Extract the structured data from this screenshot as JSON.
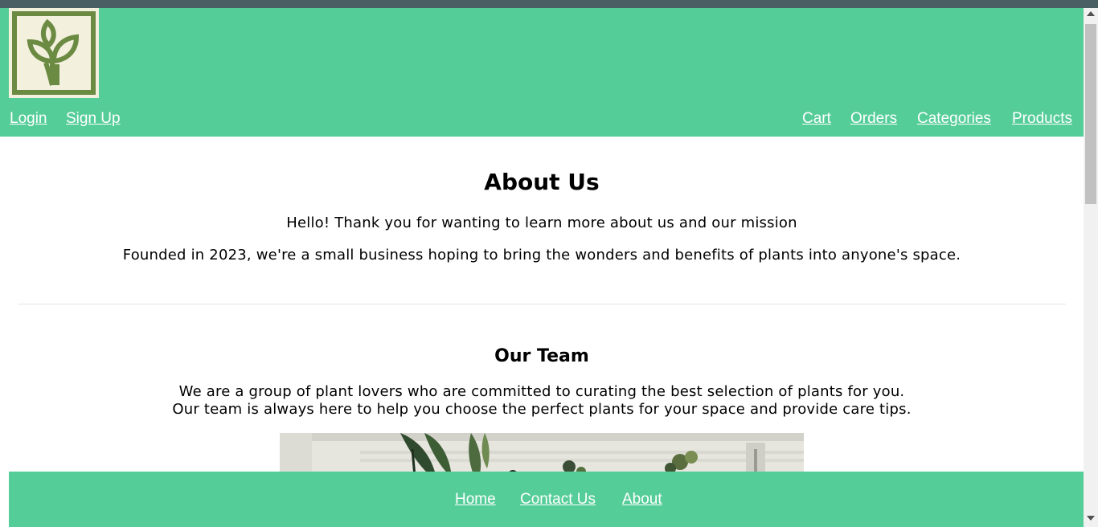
{
  "header": {
    "logo_icon": "sprout-leaf-logo-icon",
    "left_links": [
      "Login",
      "Sign Up"
    ],
    "right_links": [
      "Cart",
      "Orders",
      "Categories",
      "Products"
    ]
  },
  "about": {
    "heading": "About Us",
    "intro": "Hello! Thank you for wanting to learn more about us and our mission",
    "founded": "Founded in 2023, we're a small business hoping to bring the wonders and benefits of plants into anyone's space."
  },
  "team": {
    "heading": "Our Team",
    "line1": "We are a group of plant lovers who are committed to curating the best selection of plants for you.",
    "line2": "Our team is always here to help you choose the perfect plants for your space and provide care tips."
  },
  "footer": {
    "links": [
      "Home",
      "Contact Us",
      "About"
    ]
  },
  "colors": {
    "brand_green": "#55cd98",
    "logo_green": "#6b8a42",
    "logo_bg": "#f3f0de",
    "top_strip": "#4a5f63"
  }
}
